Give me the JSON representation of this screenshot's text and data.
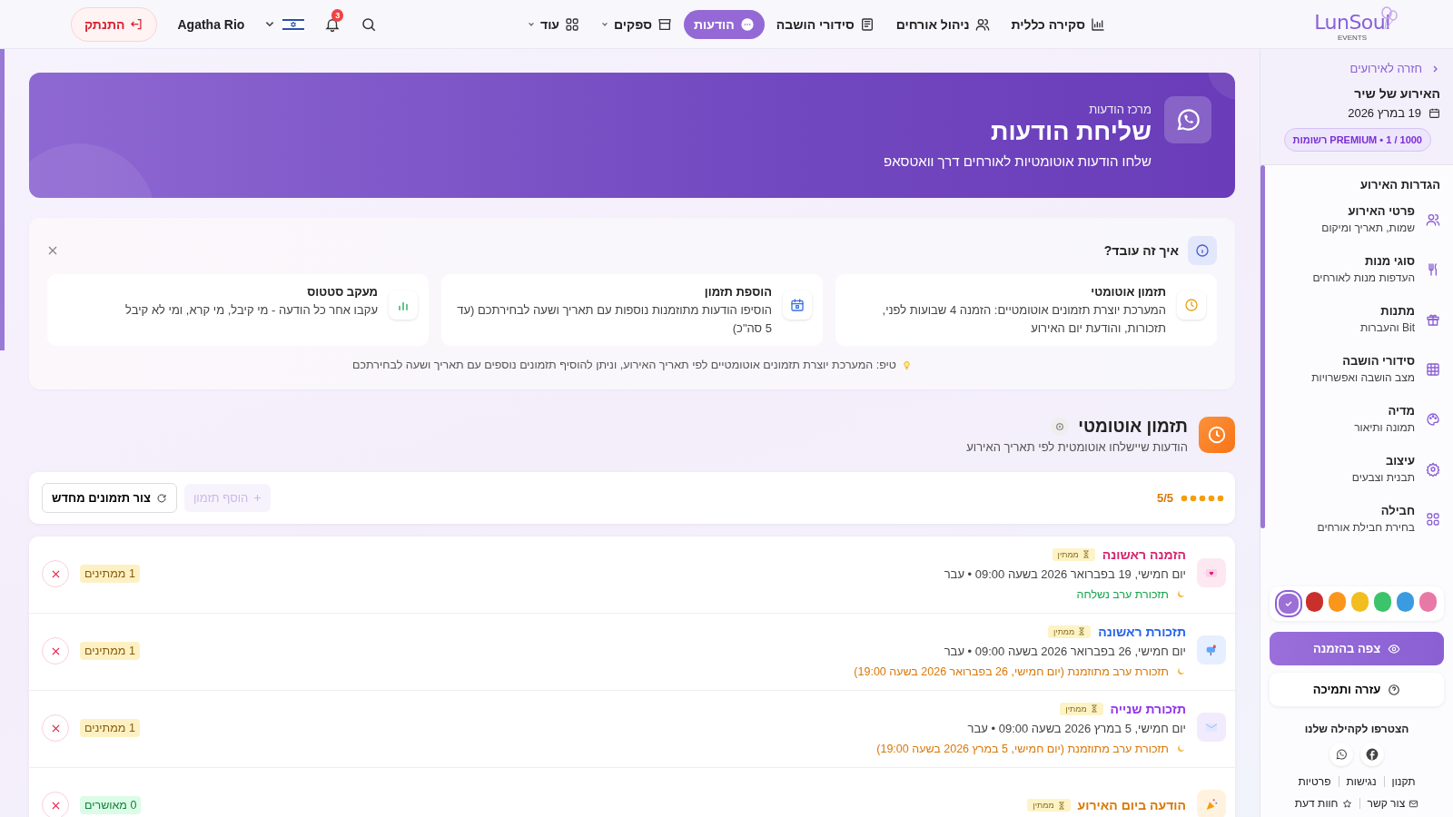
{
  "topbar": {
    "logo": "LunSoul",
    "logo_tag": "EVENTS",
    "nav": [
      {
        "label": "סקירה כללית",
        "selected": false,
        "dropdown": false
      },
      {
        "label": "ניהול אורחים",
        "selected": false,
        "dropdown": false
      },
      {
        "label": "סידורי הושבה",
        "selected": false,
        "dropdown": false
      },
      {
        "label": "הודעות",
        "selected": true,
        "dropdown": false
      },
      {
        "label": "ספקים",
        "selected": false,
        "dropdown": true
      },
      {
        "label": "עוד",
        "selected": false,
        "dropdown": true
      }
    ],
    "notifications": "3",
    "user": "Agatha Rio",
    "logout": "התנתק"
  },
  "sidebar": {
    "back": "חזרה לאירועים",
    "event_title": "האירוע של שיר",
    "event_date": "19 במרץ 2026",
    "plan": "PREMIUM",
    "usage": "• 1 / 1000 רשומות",
    "section": "הגדרות האירוע",
    "items": [
      {
        "title": "פרטי האירוע",
        "subtitle": "שמות, תאריך ומיקום"
      },
      {
        "title": "סוגי מנות",
        "subtitle": "העדפות מנות לאורחים"
      },
      {
        "title": "מתנות",
        "subtitle": "Bit והעברות"
      },
      {
        "title": "סידורי הושבה",
        "subtitle": "מצב הושבה ואפשרויות"
      },
      {
        "title": "מדיה",
        "subtitle": "תמונה ותיאור"
      },
      {
        "title": "עיצוב",
        "subtitle": "תבנית וצבעים"
      },
      {
        "title": "חבילה",
        "subtitle": "בחירת חבילת אורחים"
      }
    ],
    "swatches": [
      {
        "color": "#e879a6",
        "selected": false
      },
      {
        "color": "#3b9be0",
        "selected": false
      },
      {
        "color": "#3cc46a",
        "selected": false
      },
      {
        "color": "#f2bd1e",
        "selected": false
      },
      {
        "color": "#fb961c",
        "selected": false
      },
      {
        "color": "#c9302c",
        "selected": false
      },
      {
        "color": "#9b6fd6",
        "selected": true
      }
    ],
    "preview_button": "צפה בהזמנה",
    "help_button": "עזרה ותמיכה",
    "community": "הצטרפו לקהילה שלנו",
    "links": [
      "תקנון",
      "נגישות",
      "פרטיות"
    ],
    "contact": "צור קשר",
    "feedback": "חוות דעת"
  },
  "banner": {
    "eyebrow": "מרכז הודעות",
    "title": "שליחת הודעות",
    "description": "שלחו הודעות אוטומטיות לאורחים דרך וואטסאפ"
  },
  "how_it_works": {
    "title": "איך זה עובד?",
    "cards": [
      {
        "title": "תזמון אוטומטי",
        "text": "המערכת יוצרת תזמונים אוטומטיים: הזמנה 4 שבועות לפני, תזכורות, והודעת יום האירוע"
      },
      {
        "title": "הוספת תזמון",
        "text": "הוסיפו הודעות מתוזמנות נוספות עם תאריך ושעה לבחירתכם (עד 5 סה\"כ)"
      },
      {
        "title": "מעקב סטטוס",
        "text": "עקבו אחר כל הודעה - מי קיבל, מי קרא, ומי לא קיבל"
      }
    ],
    "tip": "טיפ: המערכת יוצרת תזמונים אוטומטיים לפי תאריך האירוע, וניתן להוסיף תזמונים נוספים עם תאריך ושעה לבחירתכם"
  },
  "schedule": {
    "title": "תזמון אוטומטי",
    "subtitle": "הודעות שיישלחו אוטומטית לפי תאריך האירוע",
    "count": "5/5",
    "level": 1,
    "add_button": {
      "label": "הוסף תזמון",
      "disabled": true
    },
    "regenerate_button": "צור תזמונים מחדש",
    "rows": [
      {
        "title": "הזמנה ראשונה",
        "color": "#d6246e",
        "status": "ממתין",
        "date": "יום חמישי, 19 בפברואר 2026 בשעה 09:00",
        "past": "• עבר",
        "reminder": {
          "text": "תזכורת ערב נשלחה",
          "kind": "sent"
        },
        "count": {
          "text": "1 ממתינים",
          "kind": "pending"
        }
      },
      {
        "title": "תזכורת ראשונה",
        "color": "#2563eb",
        "status": "ממתין",
        "date": "יום חמישי, 26 בפברואר 2026 בשעה 09:00",
        "past": "• עבר",
        "reminder": {
          "text": "תזכורת ערב מתוזמנת (יום חמישי, 26 בפברואר 2026 בשעה 19:00)",
          "kind": "scheduled"
        },
        "count": {
          "text": "1 ממתינים",
          "kind": "pending"
        }
      },
      {
        "title": "תזכורת שנייה",
        "color": "#9333ea",
        "status": "ממתין",
        "date": "יום חמישי, 5 במרץ 2026 בשעה 09:00",
        "past": "• עבר",
        "reminder": {
          "text": "תזכורת ערב מתוזמנת (יום חמישי, 5 במרץ 2026 בשעה 19:00)",
          "kind": "scheduled"
        },
        "count": {
          "text": "1 ממתינים",
          "kind": "pending"
        }
      },
      {
        "title": "הודעה ביום האירוע",
        "color": "#d97706",
        "status": "ממתין",
        "count": {
          "text": "0 מאושרים",
          "kind": "confirmed"
        }
      }
    ]
  }
}
